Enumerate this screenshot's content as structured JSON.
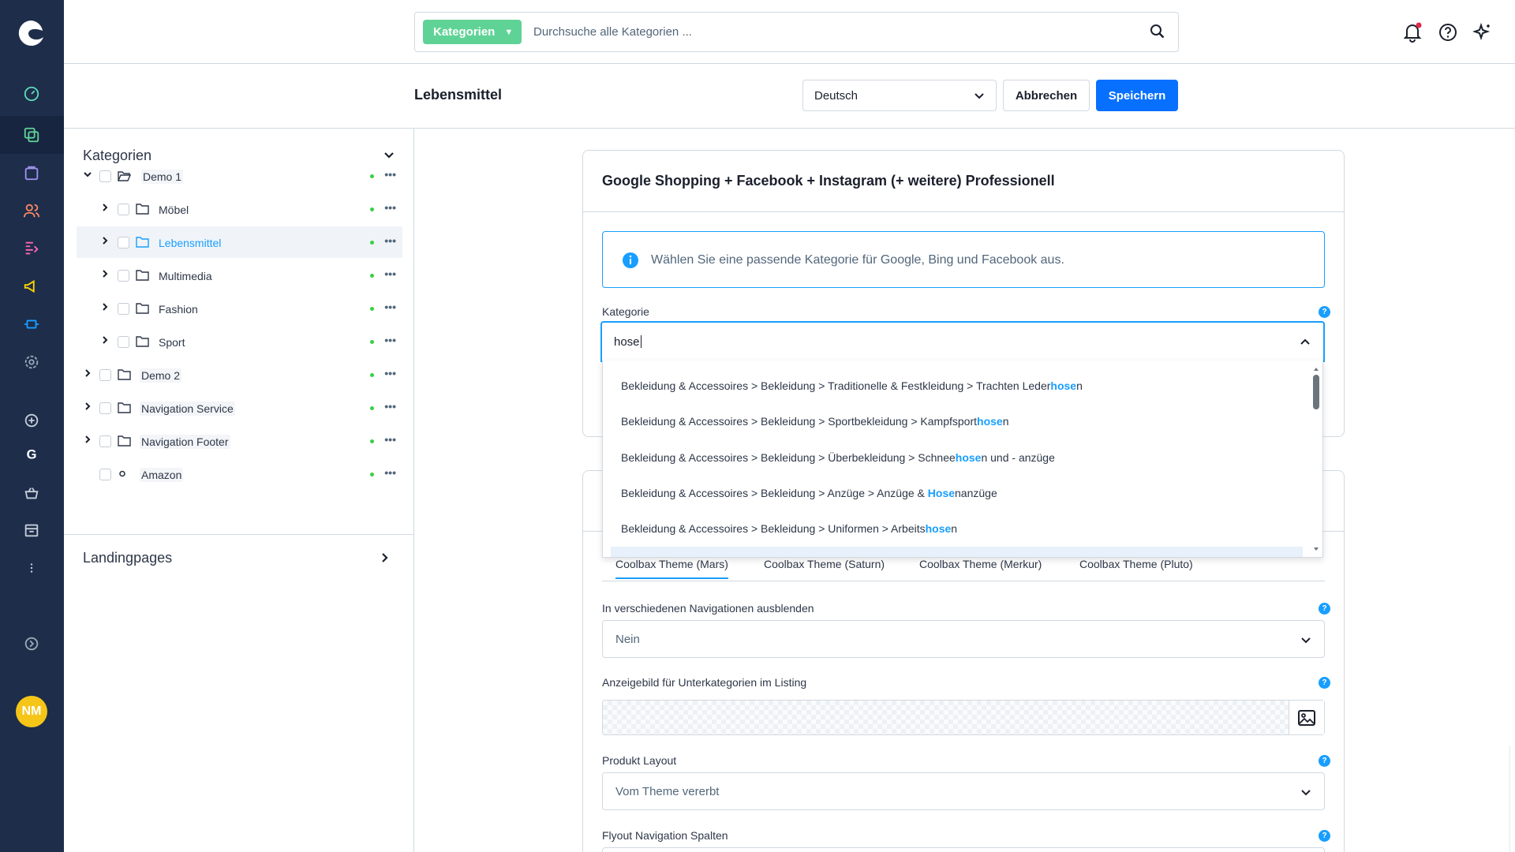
{
  "search": {
    "pill_label": "Kategorien",
    "placeholder": "Durchsuche alle Kategorien ..."
  },
  "header": {
    "title": "Lebensmittel",
    "language": "Deutsch",
    "cancel_label": "Abbrechen",
    "save_label": "Speichern"
  },
  "user": {
    "initials": "NM"
  },
  "tree": {
    "heading": "Kategorien",
    "items": [
      {
        "label": "Demo 1"
      },
      {
        "label": "Möbel"
      },
      {
        "label": "Lebensmittel"
      },
      {
        "label": "Multimedia"
      },
      {
        "label": "Fashion"
      },
      {
        "label": "Sport"
      },
      {
        "label": "Demo 2"
      },
      {
        "label": "Navigation Service"
      },
      {
        "label": "Navigation Footer"
      },
      {
        "label": "Amazon"
      }
    ],
    "landingpages": "Landingpages"
  },
  "card": {
    "title": "Google Shopping + Facebook + Instagram (+ weitere) Professionell",
    "info": "Wählen Sie eine passende Kategorie für Google, Bing und Facebook aus.",
    "kategorie_label": "Kategorie",
    "input_value": "hose"
  },
  "dropdown": {
    "options": [
      {
        "pre": "Bekleidung & Accessoires > Bekleidung > Traditionelle & Festkleidung > Trachten Leder",
        "hl": "hose",
        "post": "n"
      },
      {
        "pre": "Bekleidung & Accessoires > Bekleidung > Sportbekleidung > Kampfsport",
        "hl": "hose",
        "post": "n"
      },
      {
        "pre": "Bekleidung & Accessoires > Bekleidung > Überbekleidung > Schnee",
        "hl": "hose",
        "post": "n und - anzüge"
      },
      {
        "pre": "Bekleidung & Accessoires > Bekleidung > Anzüge > Anzüge & ",
        "hl": "Hose",
        "post": "nanzüge"
      },
      {
        "pre": "Bekleidung & Accessoires > Bekleidung > Uniformen > Arbeits",
        "hl": "hose",
        "post": "n"
      }
    ]
  },
  "theme": {
    "tabs": [
      "Coolbax Theme (Mars)",
      "Coolbax Theme (Saturn)",
      "Coolbax Theme (Merkur)",
      "Coolbax Theme (Pluto)"
    ],
    "hide_nav_label": "In verschiedenen Navigationen ausblenden",
    "hide_nav_value": "Nein",
    "image_label": "Anzeigebild für Unterkategorien im Listing",
    "layout_label": "Produkt Layout",
    "layout_value": "Vom Theme vererbt",
    "flyout_label": "Flyout Navigation Spalten"
  },
  "colors": {
    "nav_bg": "#1e2d4a",
    "accent": "#189eff",
    "green": "#5fd396",
    "avatar": "#f5c518"
  }
}
